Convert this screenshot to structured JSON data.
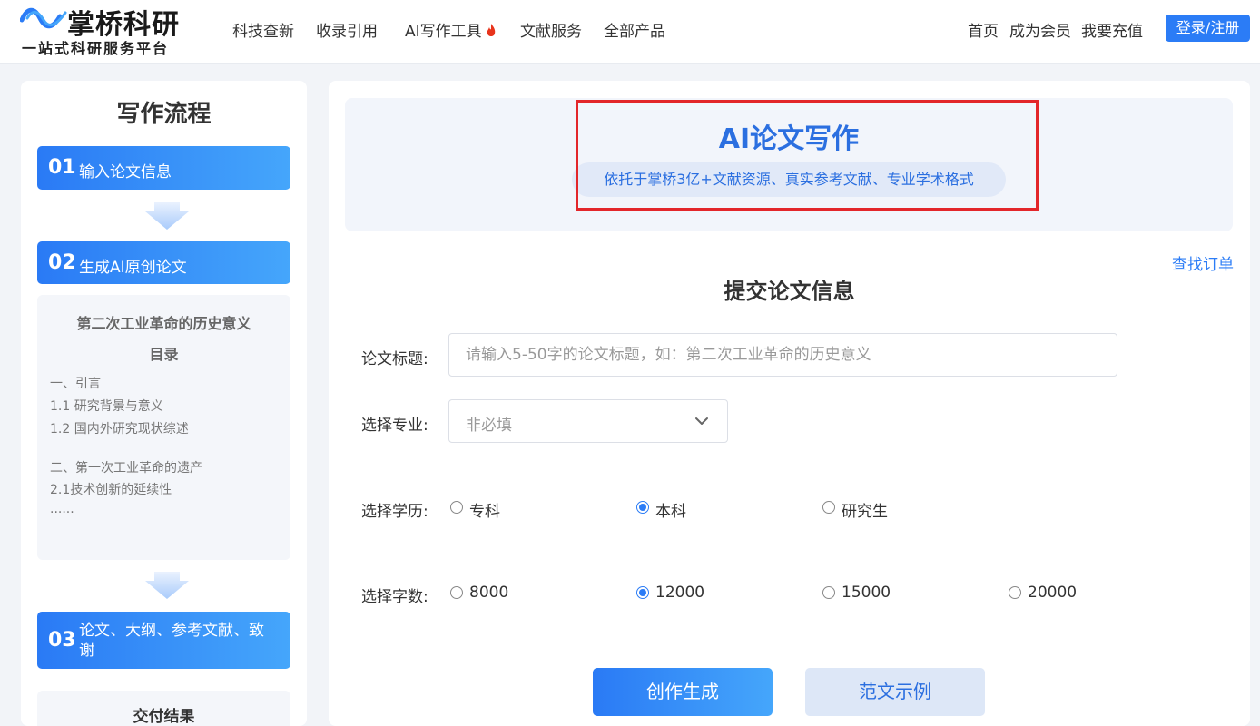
{
  "header": {
    "logo_name": "掌桥科研",
    "logo_slogan": "一站式科研服务平台",
    "nav": [
      "科技查新",
      "收录引用",
      "AI写作工具",
      "文献服务",
      "全部产品"
    ],
    "right_nav": [
      "首页",
      "成为会员",
      "我要充值"
    ],
    "login_label": "登录/注册",
    "flame_icon": "flame-icon"
  },
  "sidebar": {
    "title": "写作流程",
    "steps": [
      {
        "num": "01",
        "label": "输入论文信息"
      },
      {
        "num": "02",
        "label": "生成AI原创论文"
      },
      {
        "num": "03",
        "label": "论文、大纲、参考文献、致谢"
      }
    ],
    "toc": {
      "title": "第二次工业革命的历史意义",
      "subtitle": "目录",
      "lines": [
        "一、引言",
        "1.1 研究背景与意义",
        "1.2 国内外研究现状综述",
        "二、第一次工业革命的遗产",
        "2.1技术创新的延续性",
        "......"
      ]
    },
    "delivery_title": "交付结果"
  },
  "main": {
    "banner_title": "AI论文写作",
    "banner_sub": "依托于掌桥3亿+文献资源、真实参考文献、专业学术格式",
    "order_link": "查找订单",
    "form_title": "提交论文信息",
    "title_label": "论文标题:",
    "title_placeholder": "请输入5-50字的论文标题，如：第二次工业革命的历史意义",
    "major_label": "选择专业:",
    "major_value": "非必填",
    "edu_label": "选择学历:",
    "edu_options": [
      "专科",
      "本科",
      "研究生"
    ],
    "edu_selected": "本科",
    "words_label": "选择字数:",
    "word_options": [
      "8000",
      "12000",
      "15000",
      "20000"
    ],
    "words_selected": "12000",
    "primary_button": "创作生成",
    "secondary_button": "范文示例"
  },
  "colors": {
    "accent": "#2b7cf6",
    "highlight_box": "#e3262a"
  }
}
